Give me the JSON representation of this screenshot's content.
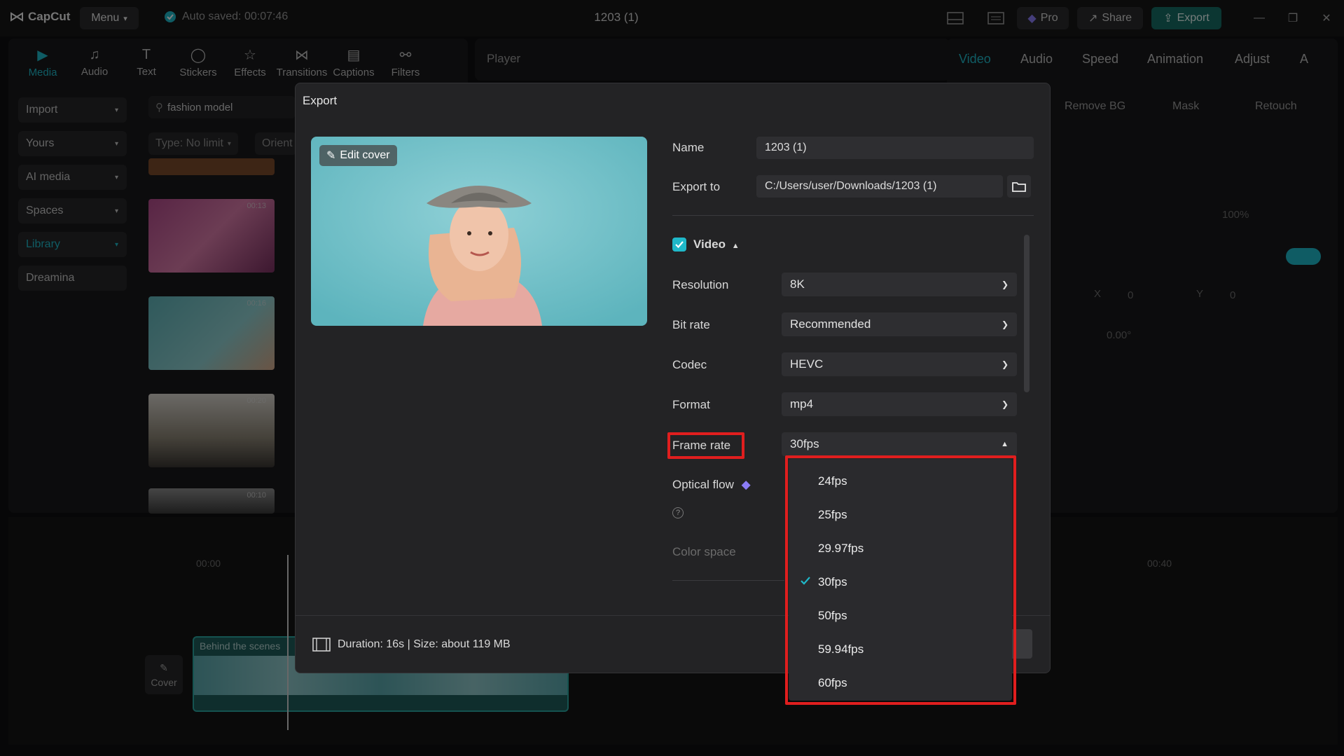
{
  "app": {
    "logo_text": "CapCut",
    "menu_label": "Menu",
    "autosave_text": "Auto saved: 00:07:46",
    "document_title": "1203 (1)",
    "pro_label": "Pro",
    "share_label": "Share",
    "export_label": "Export"
  },
  "tools": [
    {
      "label": "Media",
      "icon": "media-icon"
    },
    {
      "label": "Audio",
      "icon": "audio-icon"
    },
    {
      "label": "Text",
      "icon": "text-icon"
    },
    {
      "label": "Stickers",
      "icon": "stickers-icon"
    },
    {
      "label": "Effects",
      "icon": "effects-icon"
    },
    {
      "label": "Transitions",
      "icon": "transitions-icon"
    },
    {
      "label": "Captions",
      "icon": "captions-icon"
    },
    {
      "label": "Filters",
      "icon": "filters-icon"
    }
  ],
  "sidebar": {
    "items": [
      "Import",
      "Yours",
      "AI media",
      "Spaces",
      "Library",
      "Dreamina"
    ]
  },
  "media": {
    "search_value": "fashion model",
    "filter_type": "Type: No limit",
    "filter_orient": "Orient",
    "thumb_durations": [
      "00:13",
      "00:16",
      "00:20",
      "00:10"
    ]
  },
  "player": {
    "label": "Player"
  },
  "right_panel": {
    "tabs": [
      "Video",
      "Audio",
      "Speed",
      "Animation",
      "Adjust",
      "A"
    ],
    "subtabs": [
      "Remove BG",
      "Mask",
      "Retouch"
    ],
    "scale_value": "100%",
    "pos_x_label": "X",
    "pos_x_value": "0",
    "pos_y_label": "Y",
    "pos_y_value": "0",
    "rotate_value": "0.00°"
  },
  "timeline": {
    "time_start": "00:00",
    "time_end": "00:40",
    "clip_label": "Behind the scenes",
    "cover_label": "Cover"
  },
  "export_dialog": {
    "title": "Export",
    "edit_cover_label": "Edit cover",
    "name_label": "Name",
    "name_value": "1203 (1)",
    "export_to_label": "Export to",
    "export_to_value": "C:/Users/user/Downloads/1203 (1)",
    "video_section_label": "Video",
    "video_enabled": true,
    "resolution_label": "Resolution",
    "resolution_value": "8K",
    "bitrate_label": "Bit rate",
    "bitrate_value": "Recommended",
    "codec_label": "Codec",
    "codec_value": "HEVC",
    "format_label": "Format",
    "format_value": "mp4",
    "framerate_label": "Frame rate",
    "framerate_value": "30fps",
    "optical_flow_label": "Optical flow",
    "color_space_label": "Color space",
    "footer_info": "Duration: 16s | Size: about 119 MB",
    "framerate_options": [
      "24fps",
      "25fps",
      "29.97fps",
      "30fps",
      "50fps",
      "59.94fps",
      "60fps"
    ],
    "selected_framerate": "30fps"
  },
  "colors": {
    "accent": "#1fb8c9",
    "highlight": "#e01e1e",
    "export_button": "#166d64",
    "pro_gem": "#8b7cf6"
  }
}
